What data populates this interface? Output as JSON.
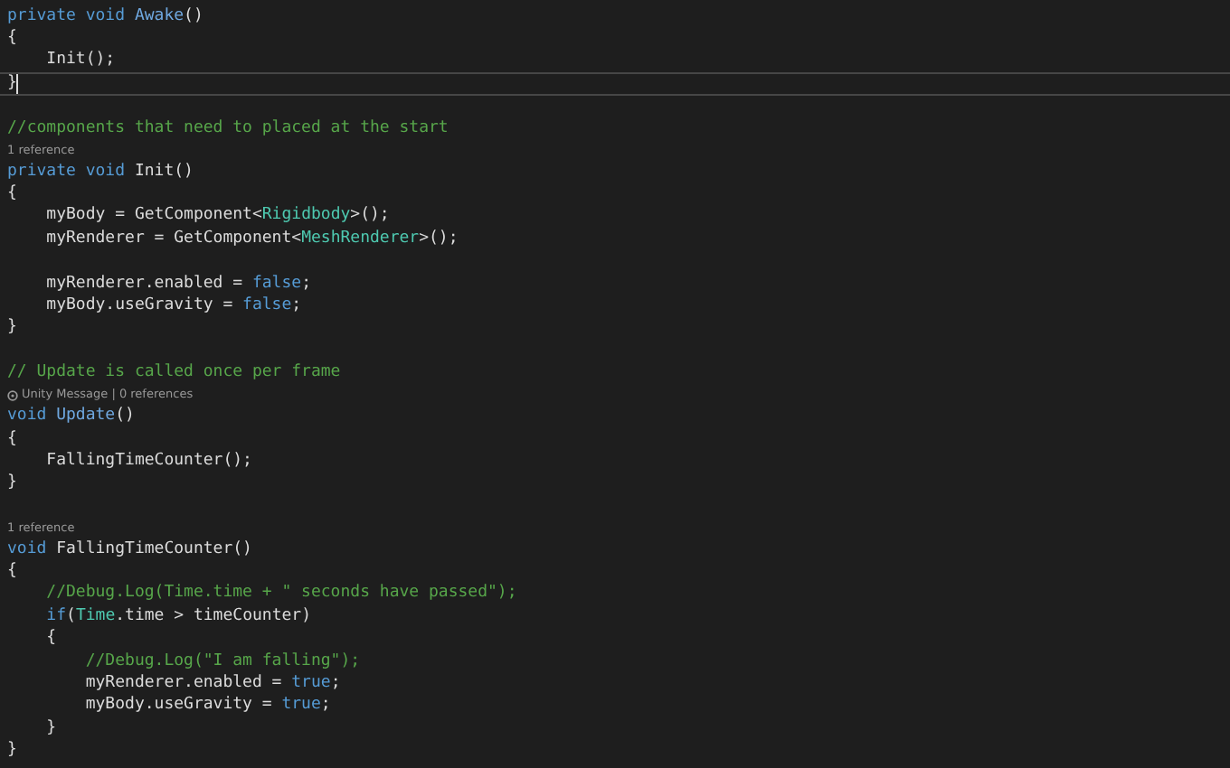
{
  "lines": [
    {
      "kind": "code",
      "current": false,
      "tokens": [
        {
          "kind": "keyword",
          "text": "private void "
        },
        {
          "kind": "message",
          "text": "Awake"
        },
        {
          "kind": "plain",
          "text": "()"
        }
      ]
    },
    {
      "kind": "code",
      "current": false,
      "tokens": [
        {
          "kind": "plain",
          "text": "{"
        }
      ]
    },
    {
      "kind": "code",
      "current": false,
      "tokens": [
        {
          "kind": "plain",
          "text": "    Init();"
        }
      ]
    },
    {
      "kind": "code",
      "current": true,
      "tokens": [
        {
          "kind": "plain",
          "text": "}"
        }
      ]
    },
    {
      "kind": "blank",
      "current": false
    },
    {
      "kind": "code",
      "current": false,
      "tokens": [
        {
          "kind": "comment",
          "text": "//components that need to placed at the start"
        }
      ]
    },
    {
      "kind": "lens",
      "current": false,
      "text": "1 reference"
    },
    {
      "kind": "code",
      "current": false,
      "tokens": [
        {
          "kind": "keyword",
          "text": "private void "
        },
        {
          "kind": "plain",
          "text": "Init()"
        }
      ]
    },
    {
      "kind": "code",
      "current": false,
      "tokens": [
        {
          "kind": "plain",
          "text": "{"
        }
      ]
    },
    {
      "kind": "code",
      "current": false,
      "tokens": [
        {
          "kind": "plain",
          "text": "    myBody = GetComponent<"
        },
        {
          "kind": "type",
          "text": "Rigidbody"
        },
        {
          "kind": "plain",
          "text": ">();"
        }
      ]
    },
    {
      "kind": "code",
      "current": false,
      "tokens": [
        {
          "kind": "plain",
          "text": "    myRenderer = GetComponent<"
        },
        {
          "kind": "type",
          "text": "MeshRenderer"
        },
        {
          "kind": "plain",
          "text": ">();"
        }
      ]
    },
    {
      "kind": "blank",
      "current": false
    },
    {
      "kind": "code",
      "current": false,
      "tokens": [
        {
          "kind": "plain",
          "text": "    myRenderer.enabled = "
        },
        {
          "kind": "keyword",
          "text": "false"
        },
        {
          "kind": "plain",
          "text": ";"
        }
      ]
    },
    {
      "kind": "code",
      "current": false,
      "tokens": [
        {
          "kind": "plain",
          "text": "    myBody.useGravity = "
        },
        {
          "kind": "keyword",
          "text": "false"
        },
        {
          "kind": "plain",
          "text": ";"
        }
      ]
    },
    {
      "kind": "code",
      "current": false,
      "tokens": [
        {
          "kind": "plain",
          "text": "}"
        }
      ]
    },
    {
      "kind": "blank",
      "current": false
    },
    {
      "kind": "code",
      "current": false,
      "tokens": [
        {
          "kind": "comment",
          "text": "// Update is called once per frame"
        }
      ]
    },
    {
      "kind": "message_lens",
      "current": false,
      "text": "Unity Message | 0 references"
    },
    {
      "kind": "code",
      "current": false,
      "tokens": [
        {
          "kind": "keyword",
          "text": "void "
        },
        {
          "kind": "message",
          "text": "Update"
        },
        {
          "kind": "plain",
          "text": "()"
        }
      ]
    },
    {
      "kind": "code",
      "current": false,
      "tokens": [
        {
          "kind": "plain",
          "text": "{"
        }
      ]
    },
    {
      "kind": "code",
      "current": false,
      "tokens": [
        {
          "kind": "plain",
          "text": "    FallingTimeCounter();"
        }
      ]
    },
    {
      "kind": "code",
      "current": false,
      "tokens": [
        {
          "kind": "plain",
          "text": "}"
        }
      ]
    },
    {
      "kind": "blank",
      "current": false
    },
    {
      "kind": "lens",
      "current": false,
      "text": "1 reference"
    },
    {
      "kind": "code",
      "current": false,
      "tokens": [
        {
          "kind": "keyword",
          "text": "void "
        },
        {
          "kind": "plain",
          "text": "FallingTimeCounter()"
        }
      ]
    },
    {
      "kind": "code",
      "current": false,
      "tokens": [
        {
          "kind": "plain",
          "text": "{"
        }
      ]
    },
    {
      "kind": "code",
      "current": false,
      "tokens": [
        {
          "kind": "comment",
          "text": "    //Debug.Log(Time.time + \" seconds have passed\");"
        }
      ]
    },
    {
      "kind": "code",
      "current": false,
      "tokens": [
        {
          "kind": "keyword",
          "text": "    if"
        },
        {
          "kind": "plain",
          "text": "("
        },
        {
          "kind": "type",
          "text": "Time"
        },
        {
          "kind": "plain",
          "text": ".time > timeCounter)"
        }
      ]
    },
    {
      "kind": "code",
      "current": false,
      "tokens": [
        {
          "kind": "plain",
          "text": "    {"
        }
      ]
    },
    {
      "kind": "code",
      "current": false,
      "tokens": [
        {
          "kind": "comment",
          "text": "        //Debug.Log(\"I am falling\");"
        }
      ]
    },
    {
      "kind": "code",
      "current": false,
      "tokens": [
        {
          "kind": "plain",
          "text": "        myRenderer.enabled = "
        },
        {
          "kind": "keyword",
          "text": "true"
        },
        {
          "kind": "plain",
          "text": ";"
        }
      ]
    },
    {
      "kind": "code",
      "current": false,
      "tokens": [
        {
          "kind": "plain",
          "text": "        myBody.useGravity = "
        },
        {
          "kind": "keyword",
          "text": "true"
        },
        {
          "kind": "plain",
          "text": ";"
        }
      ]
    },
    {
      "kind": "code",
      "current": false,
      "tokens": [
        {
          "kind": "plain",
          "text": "    }"
        }
      ]
    },
    {
      "kind": "code",
      "current": false,
      "tokens": [
        {
          "kind": "plain",
          "text": "}"
        }
      ]
    }
  ]
}
